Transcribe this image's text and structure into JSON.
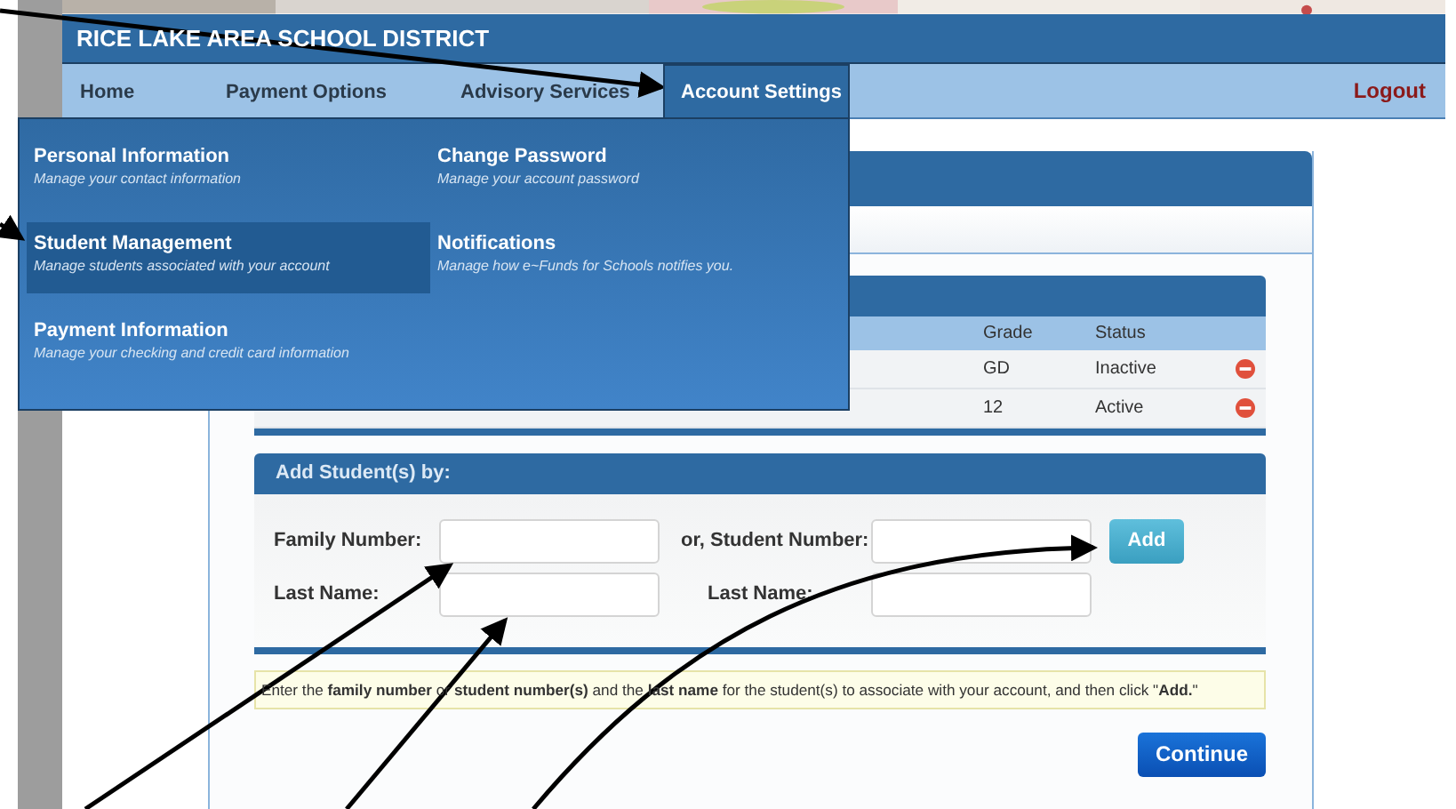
{
  "header": {
    "title": "RICE LAKE AREA SCHOOL DISTRICT"
  },
  "nav": {
    "tabs": [
      {
        "label": "Home",
        "selected": false
      },
      {
        "label": "Payment Options",
        "selected": false
      },
      {
        "label": "Advisory Services",
        "selected": false
      },
      {
        "label": "Account Settings",
        "selected": true
      }
    ],
    "logout": "Logout"
  },
  "dropdown": {
    "items": [
      {
        "title": "Personal Information",
        "description": "Manage your contact information",
        "selected": false
      },
      {
        "title": "Change Password",
        "description": "Manage your account password",
        "selected": false
      },
      {
        "title": "Student Management",
        "description": "Manage students associated with your account",
        "selected": true
      },
      {
        "title": "Notifications",
        "description": "Manage how e~Funds for Schools notifies you.",
        "selected": false
      },
      {
        "title": "Payment Information",
        "description": "Manage your checking and credit card information",
        "selected": false
      }
    ]
  },
  "students_table": {
    "columns": [
      "Grade",
      "Status"
    ],
    "rows": [
      {
        "grade": "GD",
        "status": "Inactive"
      },
      {
        "grade": "12",
        "status": "Active"
      }
    ]
  },
  "add_students": {
    "title": "Add Student(s) by:",
    "family_number_label": "Family Number:",
    "family_last_name_label": "Last Name:",
    "student_number_label": "or, Student Number:",
    "student_last_name_label": "Last Name:",
    "add_button": "Add"
  },
  "note": "Enter the **family number** or **student number(s)** and the **last name** for the student(s) to associate with your account, and then click \"**Add.**\"",
  "continue_button": "Continue"
}
